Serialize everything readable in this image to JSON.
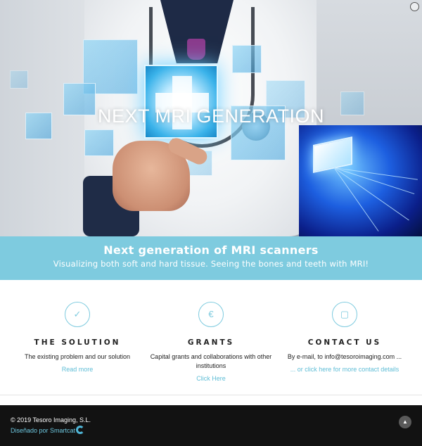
{
  "hero": {
    "title": "NEXT MRI GENERATION",
    "image_icon": "doctor-touching-hologram-image"
  },
  "banner": {
    "title": "Next generation of MRI scanners",
    "subtitle": "Visualizing both soft and hard tissue. Seeing the bones and teeth with MRI!"
  },
  "features": [
    {
      "icon": "checkmark-icon",
      "glyph": "✓",
      "title": "THE SOLUTION",
      "text": "The existing problem and our solution",
      "link": "Read more"
    },
    {
      "icon": "euro-icon",
      "glyph": "€",
      "title": "GRANTS",
      "text": "Capital grants and collaborations with other institutions",
      "link": "Click Here"
    },
    {
      "icon": "monitor-icon",
      "glyph": "▢",
      "title": "CONTACT US",
      "text": "By e-mail, to info@tesoroimaging.com ...",
      "link": "... or click here for more contact details"
    }
  ],
  "footer": {
    "copyright": "© 2019 Tesoro Imaging, S.L.",
    "credit": "Diseñado por Smartcat",
    "to_top_icon": "chevron-up-icon",
    "to_top_glyph": "▲"
  },
  "colors": {
    "accent": "#7ecbdf",
    "footer_bg": "#121212",
    "link": "#5fbdd6"
  }
}
